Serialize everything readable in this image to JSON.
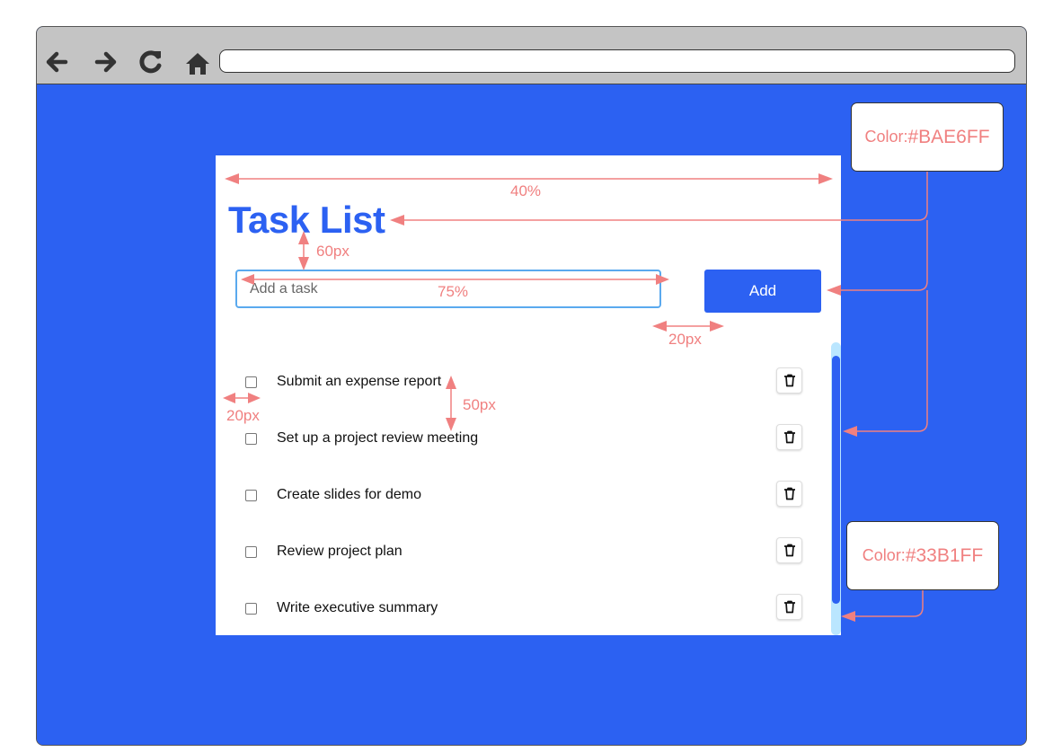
{
  "app": {
    "title": "Task List",
    "input_placeholder": "Add a task",
    "add_label": "Add",
    "tasks": [
      {
        "label": "Submit an expense report",
        "checked": false
      },
      {
        "label": "Set up a project review meeting",
        "checked": false
      },
      {
        "label": "Create slides for demo",
        "checked": false
      },
      {
        "label": "Review project plan",
        "checked": false
      },
      {
        "label": "Write executive summary",
        "checked": false
      }
    ]
  },
  "browser": {
    "icons": [
      "back-arrow-icon",
      "forward-arrow-icon",
      "reload-icon",
      "home-icon"
    ],
    "address": ""
  },
  "annotations": {
    "title_width": "40%",
    "title_gap": "60px",
    "input_width": "75%",
    "button_gap": "20px",
    "item_indent": "20px",
    "item_spacing": "50px",
    "swatch_primary_prefix": "Color:",
    "swatch_primary_hex": "#BAE6FF",
    "swatch_secondary_prefix": "Color:",
    "swatch_secondary_hex": "#33B1FF"
  },
  "colors": {
    "page_background": "#2C61F2",
    "accent": "#2C61F2",
    "input_border": "#5AA9EE",
    "annotation": "#F08080",
    "scroll_track": "#BAE6FF"
  }
}
